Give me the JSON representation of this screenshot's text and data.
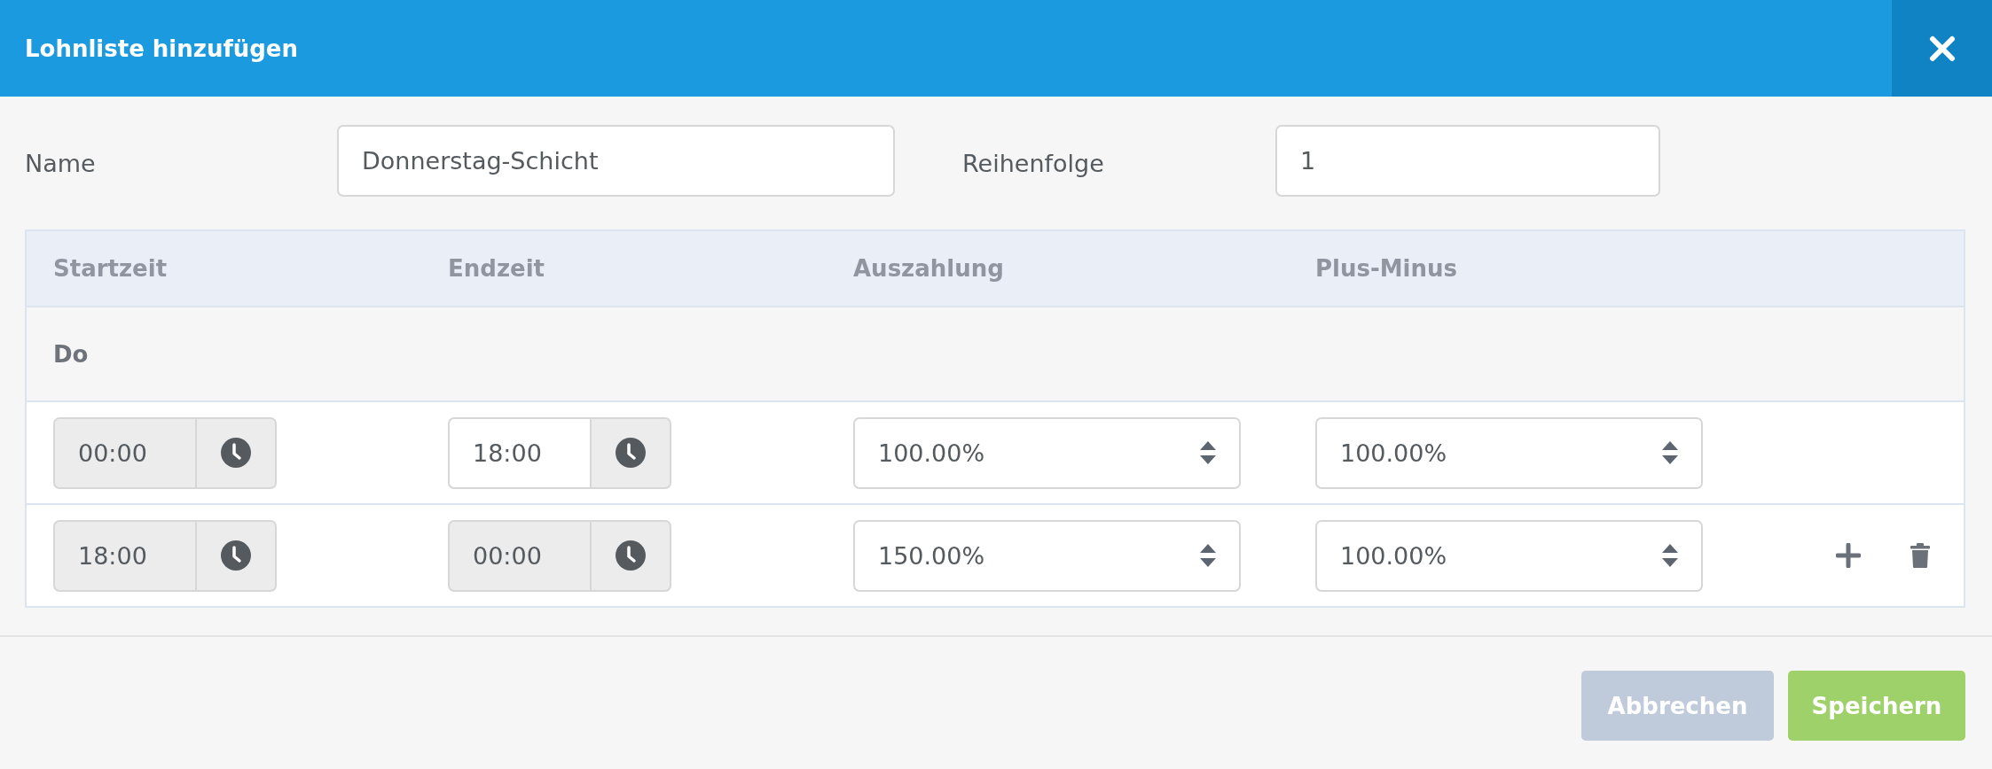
{
  "dialog": {
    "title": "Lohnliste hinzufügen"
  },
  "form": {
    "name_label": "Name",
    "name_value": "Donnerstag-Schicht",
    "order_label": "Reihenfolge",
    "order_value": "1"
  },
  "table": {
    "columns": [
      "Startzeit",
      "Endzeit",
      "Auszahlung",
      "Plus-Minus"
    ],
    "group": "Do",
    "rows": [
      {
        "start": {
          "value": "00:00",
          "disabled": true
        },
        "end": {
          "value": "18:00",
          "disabled": false
        },
        "payout": "100.00%",
        "plus_minus": "100.00%",
        "actions": false
      },
      {
        "start": {
          "value": "18:00",
          "disabled": true
        },
        "end": {
          "value": "00:00",
          "disabled": true
        },
        "payout": "150.00%",
        "plus_minus": "100.00%",
        "actions": true
      }
    ]
  },
  "buttons": [
    {
      "label": "Abbrechen",
      "kind": "cancel"
    },
    {
      "label": "Speichern",
      "kind": "save"
    }
  ]
}
